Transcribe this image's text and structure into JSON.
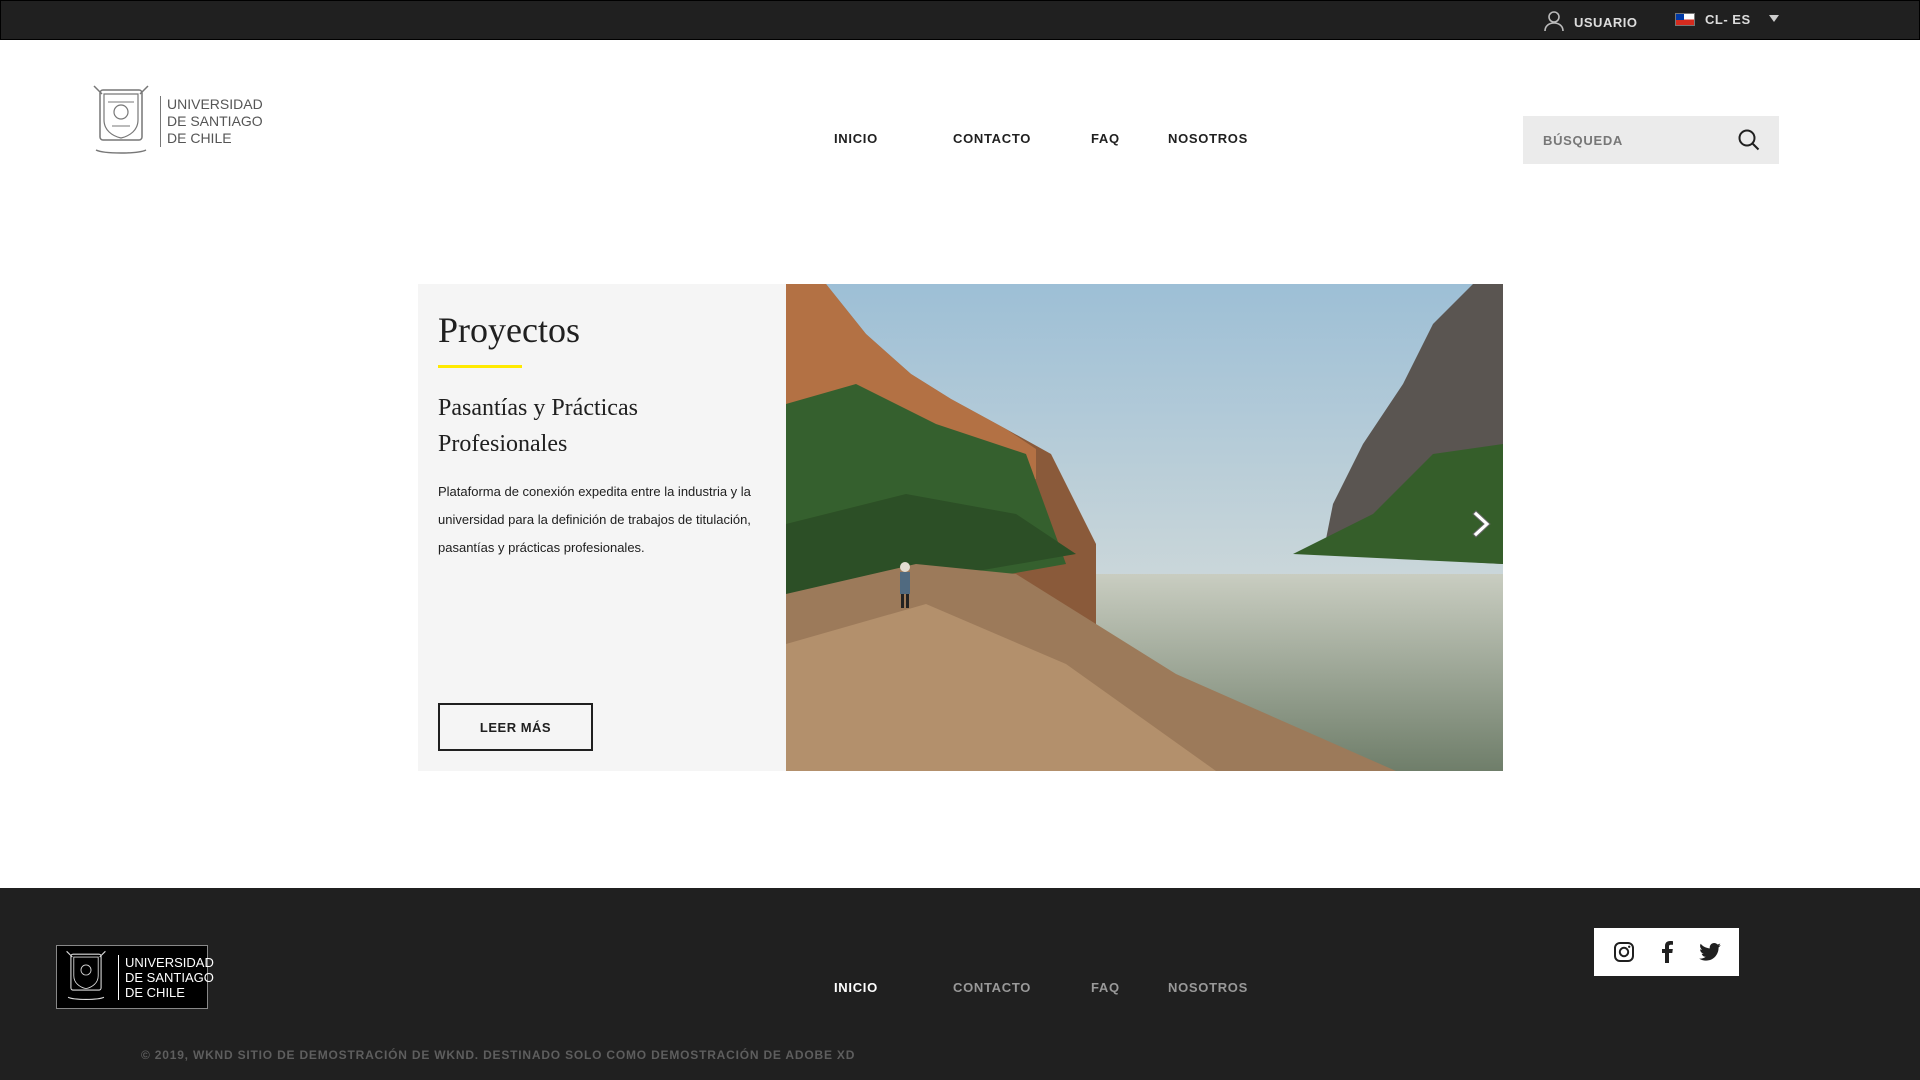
{
  "topbar": {
    "user_label": "USUARIO",
    "lang_label": "CL- ES"
  },
  "logo": {
    "line1": "UNIVERSIDAD",
    "line2": "DE SANTIAGO",
    "line3": "DE CHILE"
  },
  "nav": {
    "items": [
      "INICIO",
      "CONTACTO",
      "FAQ",
      "NOSOTROS"
    ]
  },
  "search": {
    "placeholder": "BÚSQUEDA"
  },
  "card": {
    "title": "Proyectos",
    "subtitle": "Pasantías y Prácticas Profesionales",
    "description": "Plataforma de conexión expedita entre la industria y la universidad para la definición de trabajos de titulación, pasantías y prácticas profesionales.",
    "button_label": "LEER MÁS"
  },
  "footer": {
    "nav": [
      "INICIO",
      "CONTACTO",
      "FAQ",
      "NOSOTROS"
    ],
    "social": [
      "instagram-icon",
      "facebook-icon",
      "twitter-icon"
    ],
    "copyright": "© 2019, WKND SITIO DE DEMOSTRACIÓN DE WKND. DESTINADO SOLO COMO DEMOSTRACIÓN DE ADOBE XD"
  },
  "colors": {
    "dark": "#202020",
    "accent": "#ffea00",
    "panel": "#f5f5f5"
  }
}
